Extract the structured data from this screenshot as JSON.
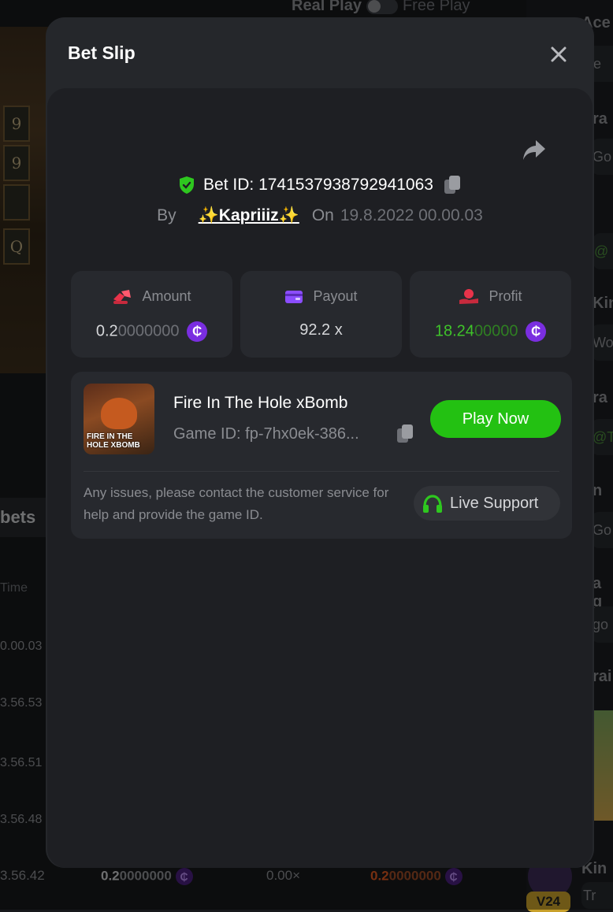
{
  "background": {
    "toggle": {
      "real_label": "Real Play",
      "free_label": "Free Play"
    },
    "slot_symbols": [
      "9",
      "9",
      "",
      "Q"
    ],
    "bets_tab_label": "bets",
    "time_header": "Time",
    "time_rows": [
      "0.00.03",
      "3.56.53",
      "3.56.51",
      "3.56.48"
    ],
    "bottom_row": {
      "time": "3.56.42",
      "amount_bright": "0.2",
      "amount_dim": "0000000",
      "payout": "0.00×",
      "profit_bright": "0.2",
      "profit_dim": "0000000",
      "coin_symbol": "₵"
    },
    "right_col": {
      "items": [
        "Ace",
        "He",
        "ra",
        "Go",
        "@",
        "Kin",
        "Wo",
        "ra",
        "@T",
        "n",
        "Go",
        "a g",
        "go",
        "rai",
        "Kin",
        "Tr"
      ],
      "vip_badge": "V24"
    }
  },
  "modal": {
    "title": "Bet Slip",
    "bet_id_label": "Bet ID:",
    "bet_id": "1741537938792941063",
    "by_label": "By",
    "username": "✨Kapriiiz✨",
    "on_label": "On",
    "date": "19.8.2022 00.00.03",
    "stats": {
      "amount": {
        "label": "Amount",
        "value_bright": "0.2",
        "value_dim": "0000000"
      },
      "payout": {
        "label": "Payout",
        "value": "92.2 x"
      },
      "profit": {
        "label": "Profit",
        "value_bright": "18.24",
        "value_dim": "00000"
      }
    },
    "coin_symbol": "₵",
    "game": {
      "name": "Fire In The Hole xBomb",
      "id_label": "Game ID:",
      "id_value": "fp-7hx0ek-386...",
      "thumb_text": "FIRE IN THE HOLE XBOMB",
      "play_label": "Play Now"
    },
    "support_text": "Any issues, please contact the customer service for help and provide the game ID.",
    "support_button": "Live Support"
  },
  "colors": {
    "accent_green": "#23c112",
    "profit_green": "#3fc32a",
    "coin_purple": "#7a2ee0",
    "shield_green": "#2ec71f"
  },
  "icons": [
    "close-icon",
    "share-icon",
    "shield-check-icon",
    "copy-icon",
    "amount-icon",
    "wallet-icon",
    "profit-icon",
    "headset-icon",
    "coin-icon"
  ]
}
